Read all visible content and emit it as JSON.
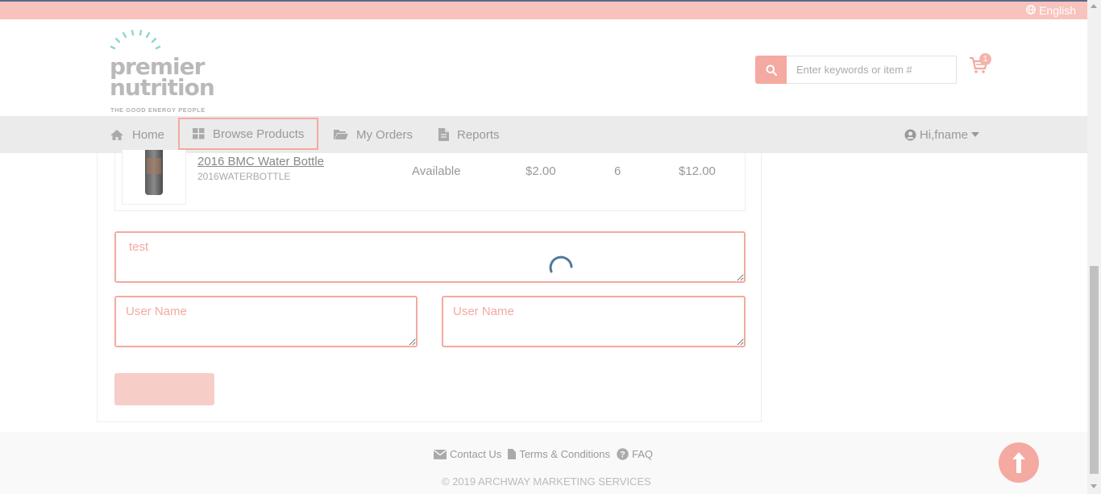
{
  "topbar": {
    "language": "English"
  },
  "brand": {
    "line1": "premier",
    "line2": "nutrition",
    "tagline": "THE GOOD ENERGY PEOPLE"
  },
  "search": {
    "placeholder": "Enter keywords or item #"
  },
  "cart": {
    "count": "1"
  },
  "nav": {
    "items": [
      {
        "label": "Home",
        "icon": "home-icon"
      },
      {
        "label": "Browse Products",
        "icon": "grid-icon"
      },
      {
        "label": "My Orders",
        "icon": "folder-icon"
      },
      {
        "label": "Reports",
        "icon": "document-icon"
      }
    ],
    "user": "Hi,fname"
  },
  "product": {
    "name": "2016 BMC Water Bottle",
    "sku": "2016WATERBOTTLE",
    "status": "Available",
    "price": "$2.00",
    "qty": "6",
    "total": "$12.00"
  },
  "form": {
    "comment_value": "test",
    "user1_placeholder": "User Name",
    "user2_placeholder": "User Name",
    "submit_label": ""
  },
  "footer": {
    "contact": "Contact Us",
    "terms": "Terms & Conditions",
    "faq": "FAQ",
    "copyright": "© 2019 ARCHWAY MARKETING SERVICES"
  },
  "colors": {
    "accent": "#f4a9a1",
    "topbar": "#f7c3bc",
    "nav_bg": "#ebebeb",
    "spinner": "#3d6a92"
  }
}
